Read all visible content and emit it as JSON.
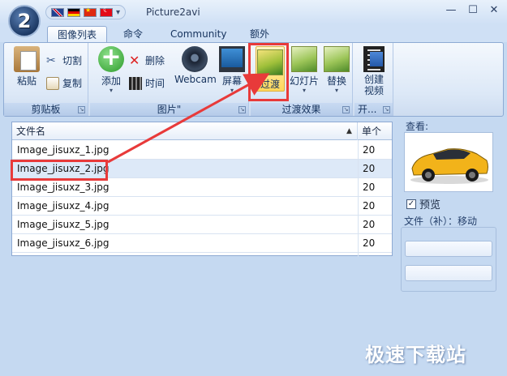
{
  "window": {
    "title": "Picture2avi",
    "app_logo": "2",
    "min_symbol": "—",
    "max_symbol": "☐",
    "close_symbol": "✕",
    "qat_more": "▾"
  },
  "tabs": [
    {
      "label": "图像列表",
      "active": true
    },
    {
      "label": "命令",
      "active": false
    },
    {
      "label": "Community",
      "active": false
    },
    {
      "label": "额外",
      "active": false
    }
  ],
  "ribbon": {
    "clipboard": {
      "label": "剪贴板",
      "paste": "粘贴",
      "cut": "切割",
      "copy": "复制"
    },
    "images": {
      "label": "图片\"",
      "add": "添加",
      "delete": "删除",
      "time": "时间",
      "webcam": "Webcam",
      "screen": "屏幕"
    },
    "transitions": {
      "label": "过渡效果",
      "transition": "过渡",
      "slideshow": "幻灯片",
      "replace": "替换"
    },
    "create": {
      "label": "开...",
      "create_video": "创建视频"
    }
  },
  "list": {
    "columns": [
      "文件名",
      "单个"
    ],
    "sort_indicator": "▲",
    "rows": [
      {
        "name": "Image_jisuxz_1.jpg",
        "count": "20",
        "selected": false
      },
      {
        "name": "Image_jisuxz_2.jpg",
        "count": "20",
        "selected": true
      },
      {
        "name": "Image_jisuxz_3.jpg",
        "count": "20",
        "selected": false
      },
      {
        "name": "Image_jisuxz_4.jpg",
        "count": "20",
        "selected": false
      },
      {
        "name": "Image_jisuxz_5.jpg",
        "count": "20",
        "selected": false
      },
      {
        "name": "Image_jisuxz_6.jpg",
        "count": "20",
        "selected": false
      }
    ]
  },
  "side_panel": {
    "view_label": "查看:",
    "preview_label": "预览",
    "preview_checked": true,
    "check_mark": "✓",
    "status": "文件（补）：移动"
  },
  "watermark": "极速下载站",
  "colors": {
    "accent": "#8eaad3",
    "highlight": "#e83a3a",
    "background": "#c5d9f1"
  }
}
